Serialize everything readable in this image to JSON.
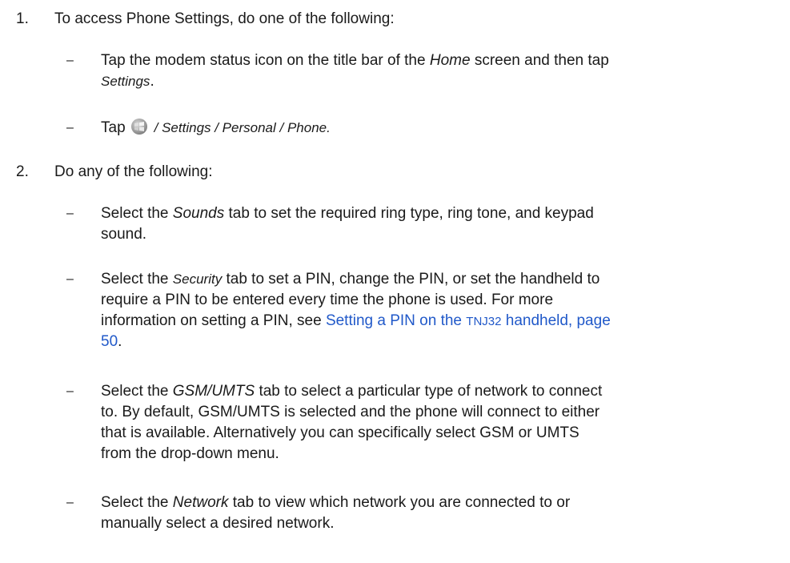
{
  "step1": {
    "number": "1.",
    "text": "To access Phone Settings, do one of the following:",
    "bullets": [
      {
        "dash": "–",
        "line1_pre": "Tap the modem status icon on the title bar of the ",
        "line1_em": "Home",
        "line1_post": " screen and then tap",
        "line2_em": "Settings",
        "line2_post": "."
      },
      {
        "dash": "–",
        "pre": "Tap ",
        "icon": "windows-start-icon",
        "post": " / Settings / Personal / Phone."
      }
    ]
  },
  "step2": {
    "number": "2.",
    "text": "Do any of the following:",
    "bullets": [
      {
        "dash": "–",
        "l1_pre": "Select the ",
        "l1_em": "Sounds",
        "l1_post": " tab to set the required ring type, ring tone, and keypad",
        "l2": "sound."
      },
      {
        "dash": "–",
        "l1_pre": "Select the ",
        "l1_em": "Security",
        "l1_post": " tab to set a PIN, change the PIN, or set the handheld to",
        "l2": "require a PIN to be entered every time the phone is used. For more",
        "l3_pre": "information on setting a PIN, see ",
        "l3_link_a": "Setting a PIN on the ",
        "l3_link_small": "TNJ32",
        "l3_link_b": " handheld, page",
        "l4_link": "50",
        "l4_post": "."
      },
      {
        "dash": "–",
        "l1_pre": "Select the ",
        "l1_em": "GSM/UMTS",
        "l1_post": " tab to select a particular type of network to connect",
        "l2": "to. By default, GSM/UMTS is selected and the phone will connect to either",
        "l3": "that is available. Alternatively you can specifically select GSM or UMTS",
        "l4": "from the drop-down menu."
      },
      {
        "dash": "–",
        "l1_pre": "Select the ",
        "l1_em": "Network",
        "l1_post": " tab to view which network you are connected to or",
        "l2": "manually select a desired network."
      }
    ]
  },
  "colors": {
    "text": "#1a1a1a",
    "link": "#2159c9"
  }
}
